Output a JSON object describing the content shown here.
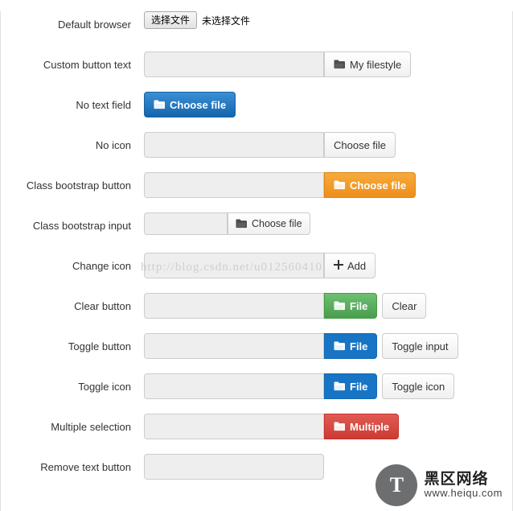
{
  "page": {
    "watermark": "http://blog.csdn.net/u012560410"
  },
  "rows": [
    {
      "label": "Default browser",
      "type": "native",
      "native_button": "选择文件",
      "native_status": "未选择文件"
    },
    {
      "label": "Custom button text",
      "type": "input-button",
      "button": "My filestyle",
      "icon": "folder-icon"
    },
    {
      "label": "No text field",
      "type": "button-only",
      "button": "Choose file",
      "icon": "folder-icon"
    },
    {
      "label": "No icon",
      "type": "input-button",
      "button": "Choose file",
      "icon": "none"
    },
    {
      "label": "Class bootstrap button",
      "type": "input-button",
      "button": "Choose file",
      "icon": "folder-icon"
    },
    {
      "label": "Class bootstrap input",
      "type": "input-button-small",
      "button": "Choose file",
      "icon": "folder-icon"
    },
    {
      "label": "Change icon",
      "type": "input-button",
      "button": "Add",
      "icon": "plus-icon"
    },
    {
      "label": "Clear button",
      "type": "input-button-extra",
      "button": "File",
      "icon": "folder-icon",
      "extra_button": "Clear"
    },
    {
      "label": "Toggle button",
      "type": "input-button-extra",
      "button": "File",
      "icon": "folder-icon",
      "extra_button": "Toggle input"
    },
    {
      "label": "Toggle icon",
      "type": "input-button-extra",
      "button": "File",
      "icon": "folder-icon",
      "extra_button": "Toggle icon"
    },
    {
      "label": "Multiple selection",
      "type": "input-button",
      "button": "Multiple",
      "icon": "folder-icon"
    },
    {
      "label": "Remove text button",
      "type": "input-only",
      "button": "",
      "icon": "none"
    }
  ],
  "logo": {
    "mark": "T",
    "chinese": "黑区网络",
    "english": "www.heiqu.com"
  }
}
